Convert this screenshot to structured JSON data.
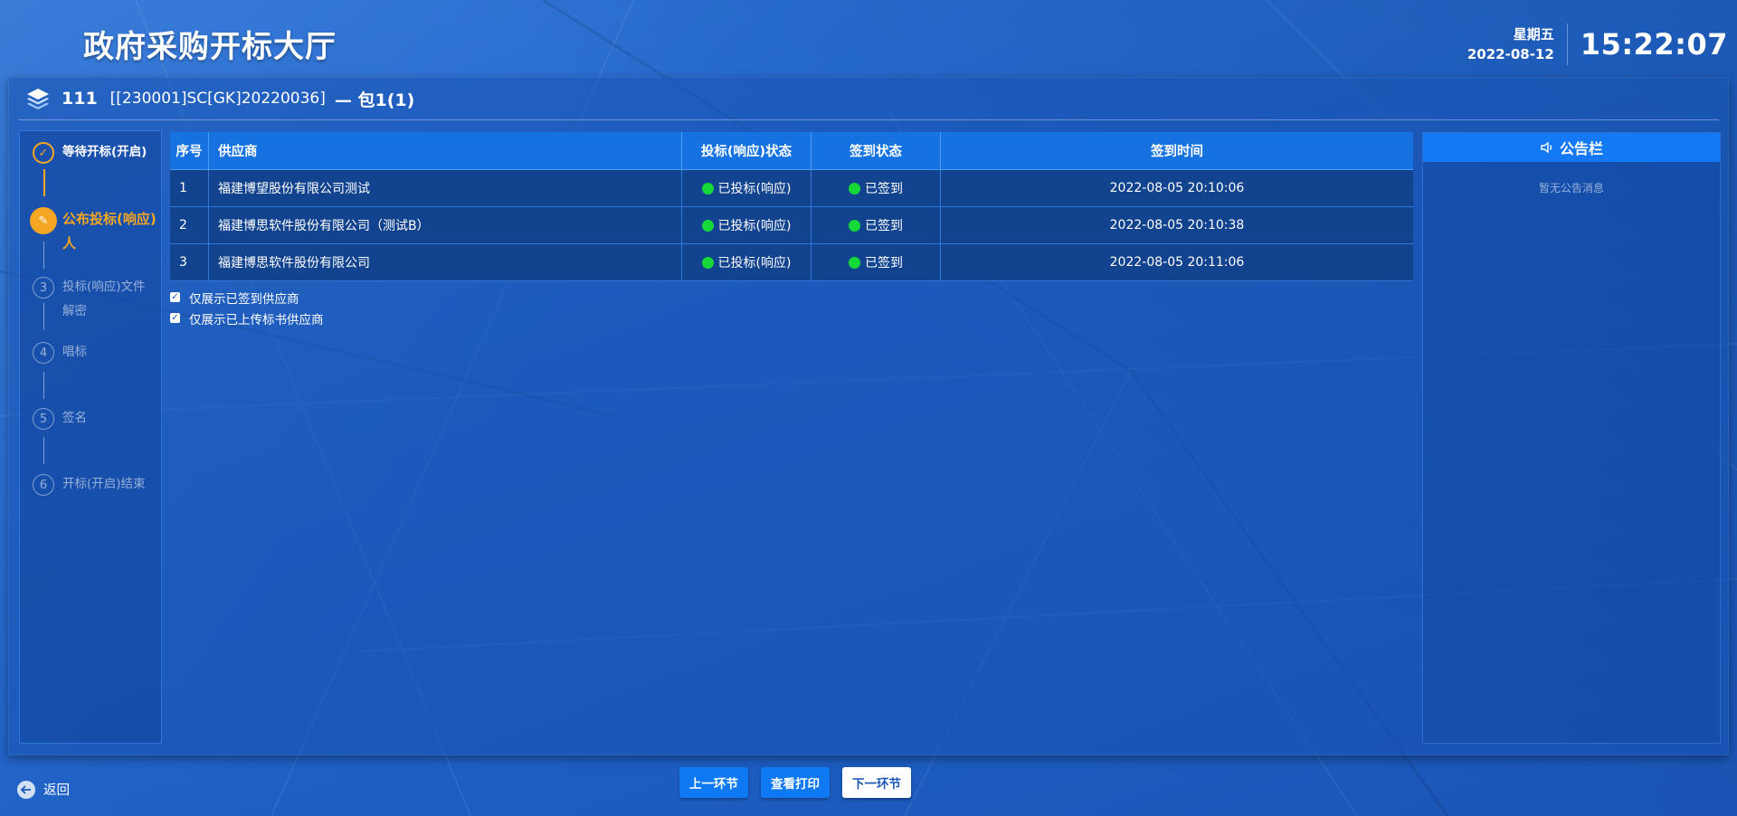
{
  "header": {
    "title": "政府采购开标大厅",
    "weekday": "星期五",
    "date": "2022-08-12",
    "time": "15:22:07"
  },
  "project": {
    "id": "111",
    "code": "[[230001]SC[GK]20220036]",
    "package": "— 包1(1)"
  },
  "steps": [
    {
      "marker": "✓",
      "label": "等待开标(开启)",
      "state": "done"
    },
    {
      "marker": "✎",
      "label": "公布投标(响应)人",
      "state": "active"
    },
    {
      "marker": "3",
      "label": "投标(响应)文件解密",
      "state": "pending"
    },
    {
      "marker": "4",
      "label": "唱标",
      "state": "pending"
    },
    {
      "marker": "5",
      "label": "签名",
      "state": "pending"
    },
    {
      "marker": "6",
      "label": "开标(开启)结束",
      "state": "pending"
    }
  ],
  "table": {
    "headers": [
      "序号",
      "供应商",
      "投标(响应)状态",
      "签到状态",
      "签到时间"
    ],
    "rows": [
      {
        "no": "1",
        "supplier": "福建博望股份有限公司测试",
        "bid_status": "已投标(响应)",
        "signin_status": "已签到",
        "signin_time": "2022-08-05 20:10:06"
      },
      {
        "no": "2",
        "supplier": "福建博思软件股份有限公司（测试B）",
        "bid_status": "已投标(响应)",
        "signin_status": "已签到",
        "signin_time": "2022-08-05 20:10:38"
      },
      {
        "no": "3",
        "supplier": "福建博思软件股份有限公司",
        "bid_status": "已投标(响应)",
        "signin_status": "已签到",
        "signin_time": "2022-08-05 20:11:06"
      }
    ]
  },
  "filters": [
    {
      "label": "仅展示已签到供应商",
      "checked": true
    },
    {
      "label": "仅展示已上传标书供应商",
      "checked": true
    }
  ],
  "notice": {
    "title": "公告栏",
    "empty_text": "暂无公告消息"
  },
  "footer": {
    "back_label": "返回",
    "prev_label": "上一环节",
    "print_label": "查看打印",
    "next_label": "下一环节"
  },
  "colors": {
    "accent_orange": "#f5a623",
    "status_green": "#16d838",
    "header_blue": "#1572e0"
  },
  "icons": {
    "project": "layers-icon",
    "notice": "speaker-icon",
    "back": "back-arrow-icon",
    "done_step": "check-icon",
    "active_step": "pen-icon"
  }
}
